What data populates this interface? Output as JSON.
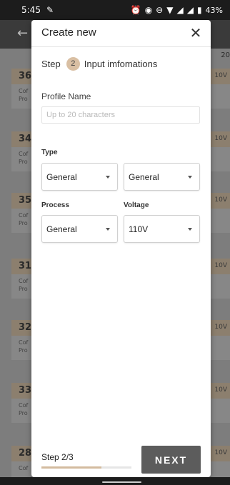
{
  "status_bar": {
    "time": "5:45",
    "battery": "43%",
    "icons": [
      "wrench-icon",
      "alarm-icon",
      "eye-icon",
      "do-not-disturb-icon",
      "wifi-icon",
      "signal-icon",
      "signal-icon",
      "battery-icon"
    ]
  },
  "background": {
    "top_right_number": "20",
    "cards": [
      {
        "num": "36",
        "voltage": "10V",
        "line1": "Cof",
        "line2": "Pro"
      },
      {
        "num": "34",
        "voltage": "10V",
        "line1": "Cof",
        "line2": "Pro"
      },
      {
        "num": "35",
        "voltage": "10V",
        "line1": "Cof",
        "line2": "Pro"
      },
      {
        "num": "31",
        "voltage": "10V",
        "line1": "Cof",
        "line2": "Pro"
      },
      {
        "num": "32",
        "voltage": "10V",
        "line1": "Cof",
        "line2": "Pro"
      },
      {
        "num": "33",
        "voltage": "10V",
        "line1": "Cof",
        "line2": "Pro"
      },
      {
        "num": "28",
        "voltage": "10V",
        "line1": "Cof",
        "line2": ""
      }
    ]
  },
  "modal": {
    "title": "Create new",
    "step_label": "Step",
    "step_number": "2",
    "step_title": "Input imfomations",
    "profile_name": {
      "label": "Profile Name",
      "placeholder": "Up to 20 characters",
      "value": ""
    },
    "type": {
      "label": "Type",
      "left_value": "General",
      "right_value": "General"
    },
    "process": {
      "label": "Process",
      "value": "General"
    },
    "voltage": {
      "label": "Voltage",
      "value": "110V"
    },
    "footer": {
      "step_progress_text": "Step 2/3",
      "progress_fraction": 0.667,
      "next_label": "NEXT"
    }
  },
  "colors": {
    "accent": "#d9bfa3",
    "next_button": "#5c5c5c",
    "card_header": "#8c7f6e"
  }
}
